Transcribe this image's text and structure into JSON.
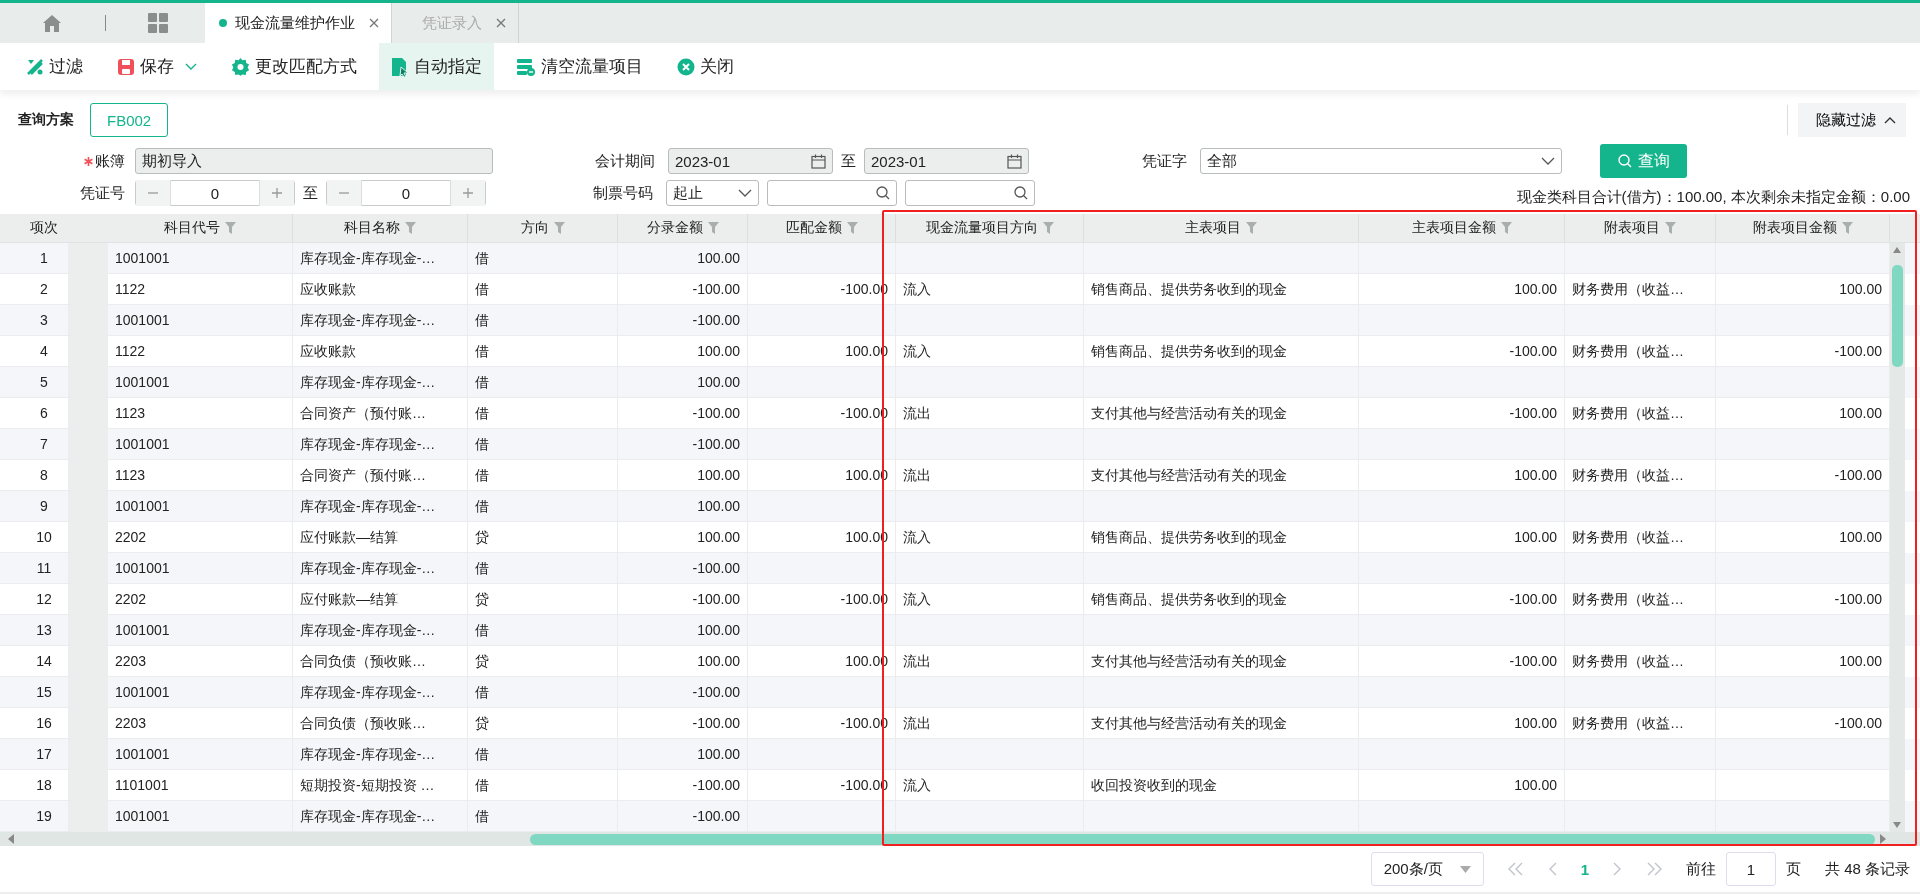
{
  "tabs": [
    {
      "label": "现金流量维护作业",
      "selected": true
    },
    {
      "label": "凭证录入",
      "selected": false
    }
  ],
  "toolbar": [
    {
      "label": "过滤",
      "kind": "filter",
      "selected": false
    },
    {
      "label": "保存",
      "kind": "save",
      "selected": false
    },
    {
      "label": "更改匹配方式",
      "kind": "gear",
      "selected": false
    },
    {
      "label": "自动指定",
      "kind": "auto",
      "selected": true
    },
    {
      "label": "清空流量项目",
      "kind": "clear",
      "selected": false
    },
    {
      "label": "关闭",
      "kind": "close",
      "selected": false
    }
  ],
  "query_plan": {
    "label": "查询方案",
    "value": "FB002"
  },
  "hide_filter": "隐藏过滤",
  "form": {
    "ledger": {
      "label": "账簿",
      "required": true,
      "value": "期初导入"
    },
    "voucher_no": {
      "label": "凭证号",
      "from": "0",
      "sep": "至",
      "to": "0"
    },
    "period": {
      "label": "会计期间",
      "from": "2023-01",
      "sep": "至",
      "to": "2023-01"
    },
    "ticket_no": {
      "label": "制票号码",
      "mode": "起止"
    },
    "voucher_type": {
      "label": "凭证字",
      "value": "全部"
    },
    "query_button": "查询"
  },
  "summary": "现金类科目合计(借方)：100.00, 本次剩余未指定金额：0.00",
  "table": {
    "columns": [
      "项次",
      "科目代号",
      "科目名称",
      "方向",
      "分录金额",
      "匹配金额",
      "现金流量项目方向",
      "主表项目",
      "主表项目金额",
      "附表项目",
      "附表项目金额"
    ],
    "rows": [
      [
        "1",
        "1001001",
        "库存现金-库存现金-…",
        "借",
        "100.00"
      ],
      [
        "2",
        "1122",
        "应收账款",
        "借",
        "-100.00",
        "-100.00",
        "流入",
        "销售商品、提供劳务收到的现金",
        "100.00",
        "财务费用（收益…",
        "100.00"
      ],
      [
        "3",
        "1001001",
        "库存现金-库存现金-…",
        "借",
        "-100.00"
      ],
      [
        "4",
        "1122",
        "应收账款",
        "借",
        "100.00",
        "100.00",
        "流入",
        "销售商品、提供劳务收到的现金",
        "-100.00",
        "财务费用（收益…",
        "-100.00"
      ],
      [
        "5",
        "1001001",
        "库存现金-库存现金-…",
        "借",
        "100.00"
      ],
      [
        "6",
        "1123",
        "合同资产（预付账…",
        "借",
        "-100.00",
        "-100.00",
        "流出",
        "支付其他与经营活动有关的现金",
        "-100.00",
        "财务费用（收益…",
        "100.00"
      ],
      [
        "7",
        "1001001",
        "库存现金-库存现金-…",
        "借",
        "-100.00"
      ],
      [
        "8",
        "1123",
        "合同资产（预付账…",
        "借",
        "100.00",
        "100.00",
        "流出",
        "支付其他与经营活动有关的现金",
        "100.00",
        "财务费用（收益…",
        "-100.00"
      ],
      [
        "9",
        "1001001",
        "库存现金-库存现金-…",
        "借",
        "100.00"
      ],
      [
        "10",
        "2202",
        "应付账款—结算",
        "贷",
        "100.00",
        "100.00",
        "流入",
        "销售商品、提供劳务收到的现金",
        "100.00",
        "财务费用（收益…",
        "100.00"
      ],
      [
        "11",
        "1001001",
        "库存现金-库存现金-…",
        "借",
        "-100.00"
      ],
      [
        "12",
        "2202",
        "应付账款—结算",
        "贷",
        "-100.00",
        "-100.00",
        "流入",
        "销售商品、提供劳务收到的现金",
        "-100.00",
        "财务费用（收益…",
        "-100.00"
      ],
      [
        "13",
        "1001001",
        "库存现金-库存现金-…",
        "借",
        "100.00"
      ],
      [
        "14",
        "2203",
        "合同负债（预收账…",
        "贷",
        "100.00",
        "100.00",
        "流出",
        "支付其他与经营活动有关的现金",
        "-100.00",
        "财务费用（收益…",
        "100.00"
      ],
      [
        "15",
        "1001001",
        "库存现金-库存现金-…",
        "借",
        "-100.00"
      ],
      [
        "16",
        "2203",
        "合同负债（预收账…",
        "贷",
        "-100.00",
        "-100.00",
        "流出",
        "支付其他与经营活动有关的现金",
        "100.00",
        "财务费用（收益…",
        "-100.00"
      ],
      [
        "17",
        "1001001",
        "库存现金-库存现金-…",
        "借",
        "100.00"
      ],
      [
        "18",
        "1101001",
        "短期投资-短期投资 …",
        "借",
        "-100.00",
        "-100.00",
        "流入",
        "收回投资收到的现金",
        "100.00"
      ],
      [
        "19",
        "1001001",
        "库存现金-库存现金-…",
        "借",
        "-100.00"
      ]
    ]
  },
  "pagination": {
    "page_size": "200条/页",
    "pages": [
      {
        "label": "1",
        "selected": true
      }
    ],
    "goto_label": "前往",
    "goto_value": "1",
    "page_unit": "页",
    "total": "共 48 条记录"
  }
}
